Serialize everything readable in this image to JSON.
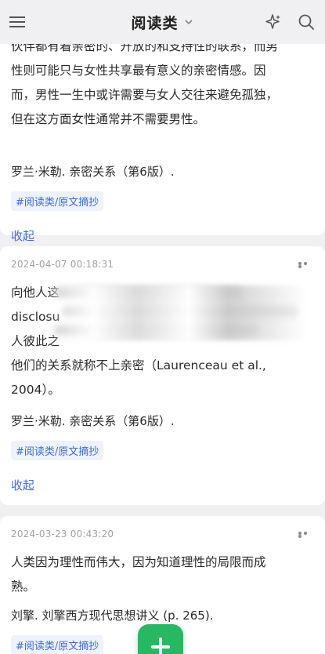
{
  "header": {
    "title": "阅读类"
  },
  "icons": {
    "menu": "hamburger-menu-icon",
    "dropdown": "chevron-down-icon",
    "ai": "sparkle-icon",
    "search": "search-icon",
    "more": "more-dots-icon",
    "add": "plus-icon"
  },
  "colors": {
    "accent": "#3f6bd8",
    "fab": "#29b862",
    "tag_bg": "#eef2fb"
  },
  "notes": [
    {
      "lines": [
        "伙伴都有着亲密的、开放的和支持性的联系，而男",
        "性则可能只与女性共享最有意义的亲密情感。因",
        "而，男性一生中或许需要与女人交往来避免孤独，",
        "但在这方面女性通常并不需要男性。"
      ],
      "source": "罗兰·米勒. 亲密关系（第6版）.",
      "tag": "#阅读类/原文摘抄",
      "collapse": "收起"
    },
    {
      "time": "2024-04-07 00:18:31",
      "lines": [
        "向他人这",
        "disclosu",
        "人彼此之",
        "他们的关系就称不上亲密（Laurenceau et al.,",
        "2004）。"
      ],
      "source": "罗兰·米勒. 亲密关系（第6版）.",
      "tag": "#阅读类/原文摘抄",
      "collapse": "收起"
    },
    {
      "time": "2024-03-23 00:43:20",
      "lines": [
        "人类因为理性而伟大，因为知道理性的局限而成",
        "熟。"
      ],
      "source": "刘擎. 刘擎西方现代思想讲义 (p. 265).",
      "tag": "#阅读类/原文摘抄"
    }
  ]
}
